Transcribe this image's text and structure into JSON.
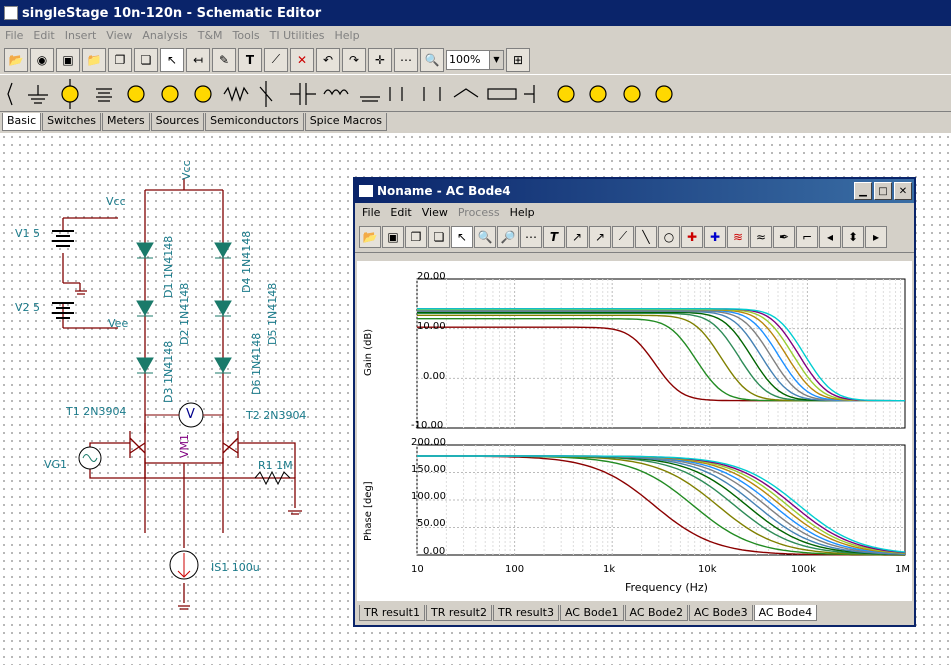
{
  "app": {
    "title": "singleStage 10n-120n - Schematic Editor"
  },
  "menu": [
    "File",
    "Edit",
    "Insert",
    "View",
    "Analysis",
    "T&M",
    "Tools",
    "TI Utilities",
    "Help"
  ],
  "toolbar": {
    "zoom": "100%"
  },
  "component_tabs": [
    "Basic",
    "Switches",
    "Meters",
    "Sources",
    "Semiconductors",
    "Spice Macros"
  ],
  "schematic": {
    "labels": {
      "vcc_top": "Vcc",
      "vcc_left": "Vcc",
      "vee": "Vee",
      "v1": "V1 5",
      "v2": "V2 5",
      "d1": "D1 1N4148",
      "d2": "D2 1N4148",
      "d3": "D3 1N4148",
      "d4": "D4 1N4148",
      "d5": "D5 1N4148",
      "d6": "D6 1N4148",
      "t1": "T1 2N3904",
      "t2": "T2 2N3904",
      "vm1": "VM1",
      "vg1": "VG1",
      "r1": "R1 1M",
      "is1": "IS1 100u",
      "meter_v": "V"
    }
  },
  "bode_window": {
    "title": "Noname - AC Bode4",
    "menu": [
      "File",
      "Edit",
      "View",
      "Process",
      "Help"
    ],
    "bottom_tabs": [
      "TR result1",
      "TR result2",
      "TR result3",
      "AC Bode1",
      "AC Bode2",
      "AC Bode3",
      "AC Bode4"
    ]
  },
  "chart_data": [
    {
      "type": "line",
      "ylabel": "Gain (dB)",
      "xlabel": "",
      "xscale": "log",
      "xlim": [
        10,
        1000000
      ],
      "ylim": [
        -10,
        20
      ],
      "yticks": [
        "20.00",
        "10.00",
        "0.00",
        "-10.00"
      ],
      "grid": true,
      "series_count": 12,
      "low_freq_gain": [
        10.3,
        12.0,
        12.7,
        13.1,
        13.3,
        13.5,
        13.6,
        13.7,
        13.8,
        13.9,
        14.0,
        14.0
      ],
      "corner_freq": [
        1800,
        4500,
        8000,
        12000,
        16000,
        20000,
        25000,
        30000,
        36000,
        42000,
        48000,
        55000
      ],
      "high_freq_gain": -4.5,
      "colors": [
        "#8b0000",
        "#228b22",
        "#808000",
        "#2e8b57",
        "#006400",
        "#4682b4",
        "#808080",
        "#1e90ff",
        "#b8860b",
        "#9acd32",
        "#800080",
        "#00ced1"
      ]
    },
    {
      "type": "line",
      "ylabel": "Phase [deg]",
      "xlabel": "Frequency (Hz)",
      "xscale": "log",
      "xlim": [
        10,
        1000000
      ],
      "ylim": [
        0,
        200
      ],
      "yticks": [
        "200.00",
        "150.00",
        "100.00",
        "50.00",
        "0.00"
      ],
      "xticks": [
        "10",
        "100",
        "1k",
        "10k",
        "100k",
        "1M"
      ],
      "grid": true,
      "start_phase": 180,
      "end_phase": 0
    }
  ]
}
